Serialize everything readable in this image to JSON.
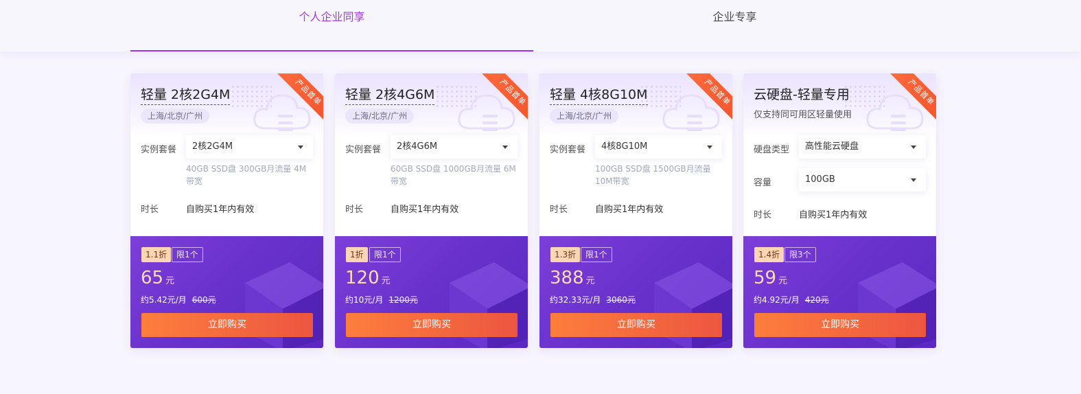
{
  "tabs": [
    {
      "label": "个人企业同享",
      "active": true
    },
    {
      "label": "企业专享",
      "active": false
    }
  ],
  "accent_color": "#a630e4",
  "cards": [
    {
      "ribbon": "产品首单",
      "title": "轻量 2核2G4M",
      "region": "上海/北京/广州",
      "spec_label": "实例套餐",
      "spec_value": "2核2G4M",
      "spec_desc": "40GB SSD盘 300GB月流量 4M带宽",
      "duration_label": "时长",
      "duration_value": "自购买1年内有效",
      "discount": "1.1折",
      "limit": "限1个",
      "price": "65",
      "price_unit": "元",
      "monthly": "约5.42元/月",
      "original_price": "600元",
      "buy_label": "立即购买"
    },
    {
      "ribbon": "产品首单",
      "title": "轻量 2核4G6M",
      "region": "上海/北京/广州",
      "spec_label": "实例套餐",
      "spec_value": "2核4G6M",
      "spec_desc": "60GB SSD盘 1000GB月流量 6M带宽",
      "duration_label": "时长",
      "duration_value": "自购买1年内有效",
      "discount": "1折",
      "limit": "限1个",
      "price": "120",
      "price_unit": "元",
      "monthly": "约10元/月",
      "original_price": "1200元",
      "buy_label": "立即购买"
    },
    {
      "ribbon": "产品首单",
      "title": "轻量 4核8G10M",
      "region": "上海/北京/广州",
      "spec_label": "实例套餐",
      "spec_value": "4核8G10M",
      "spec_desc": "100GB SSD盘 1500GB月流量 10M带宽",
      "duration_label": "时长",
      "duration_value": "自购买1年内有效",
      "discount": "1.3折",
      "limit": "限1个",
      "price": "388",
      "price_unit": "元",
      "monthly": "约32.33元/月",
      "original_price": "3060元",
      "buy_label": "立即购买"
    },
    {
      "ribbon": "产品首单",
      "title": "云硬盘-轻量专用",
      "subtitle": "仅支持同可用区轻量使用",
      "disk_type_label": "硬盘类型",
      "disk_type_value": "高性能云硬盘",
      "capacity_label": "容量",
      "capacity_value": "100GB",
      "duration_label": "时长",
      "duration_value": "自购买1年内有效",
      "discount": "1.4折",
      "limit": "限3个",
      "price": "59",
      "price_unit": "元",
      "monthly": "约4.92元/月",
      "original_price": "420元",
      "buy_label": "立即购买"
    }
  ]
}
